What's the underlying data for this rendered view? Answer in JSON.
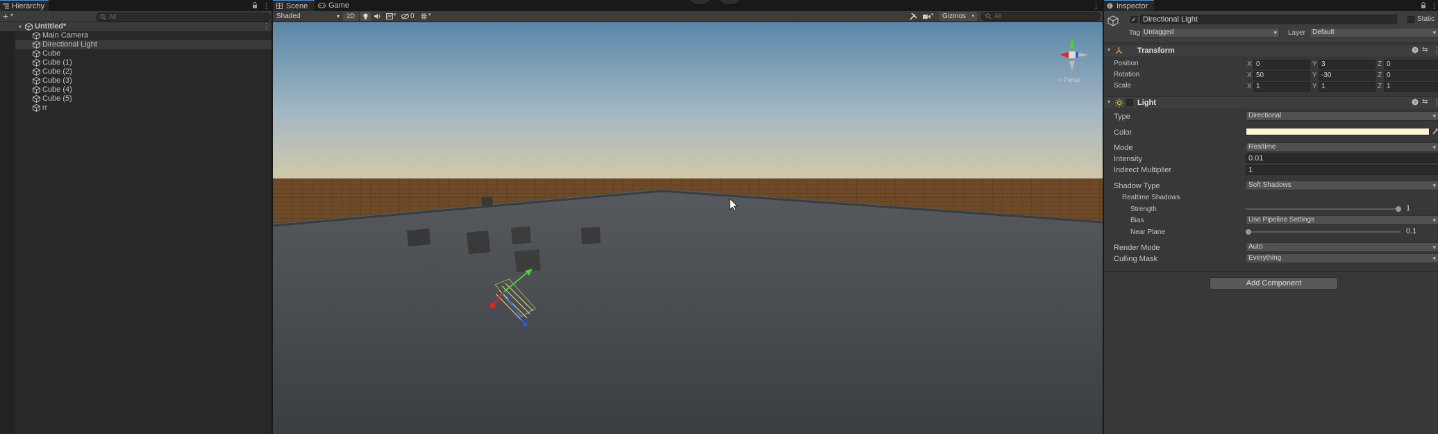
{
  "hierarchy": {
    "tab_label": "Hierarchy",
    "search_placeholder": "All",
    "scene_name": "Untitled*",
    "items": [
      {
        "label": "Main Camera"
      },
      {
        "label": "Directional Light"
      },
      {
        "label": "Cube"
      },
      {
        "label": "Cube (1)"
      },
      {
        "label": "Cube (2)"
      },
      {
        "label": "Cube (3)"
      },
      {
        "label": "Cube (4)"
      },
      {
        "label": "Cube (5)"
      },
      {
        "label": "rr"
      }
    ]
  },
  "scene": {
    "tabs": [
      "Scene",
      "Game"
    ],
    "shading_mode": "Shaded",
    "mode_2d": "2D",
    "hidden_count": "0",
    "gizmos_label": "Gizmos",
    "search_placeholder": "All",
    "persp_label": "< Persp"
  },
  "inspector": {
    "tab_label": "Inspector",
    "object_name": "Directional Light",
    "static_label": "Static",
    "tag_label": "Tag",
    "tag_value": "Untagged",
    "layer_label": "Layer",
    "layer_value": "Default",
    "transform": {
      "title": "Transform",
      "position_label": "Position",
      "rotation_label": "Rotation",
      "scale_label": "Scale",
      "position": {
        "x": "0",
        "y": "3",
        "z": "0"
      },
      "rotation": {
        "x": "50",
        "y": "-30",
        "z": "0"
      },
      "scale": {
        "x": "1",
        "y": "1",
        "z": "1"
      }
    },
    "light": {
      "title": "Light",
      "type_label": "Type",
      "type_value": "Directional",
      "color_label": "Color",
      "color_value": "#fff4d6",
      "mode_label": "Mode",
      "mode_value": "Realtime",
      "intensity_label": "Intensity",
      "intensity_value": "0.01",
      "indirect_label": "Indirect Multiplier",
      "indirect_value": "1",
      "shadow_type_label": "Shadow Type",
      "shadow_type_value": "Soft Shadows",
      "realtime_shadows_label": "Realtime Shadows",
      "strength_label": "Strength",
      "strength_value": "1",
      "bias_label": "Bias",
      "bias_value": "Use Pipeline Settings",
      "near_plane_label": "Near Plane",
      "near_plane_value": "0.1",
      "render_mode_label": "Render Mode",
      "render_mode_value": "Auto",
      "culling_mask_label": "Culling Mask",
      "culling_mask_value": "Everything"
    },
    "add_component_label": "Add Component"
  },
  "colors": {
    "selection_blue": "#4a90d9",
    "light_color": "#fff4d6",
    "axis_x": "#d42a2a",
    "axis_y": "#4ccf3a",
    "axis_z": "#2a5bd4"
  }
}
